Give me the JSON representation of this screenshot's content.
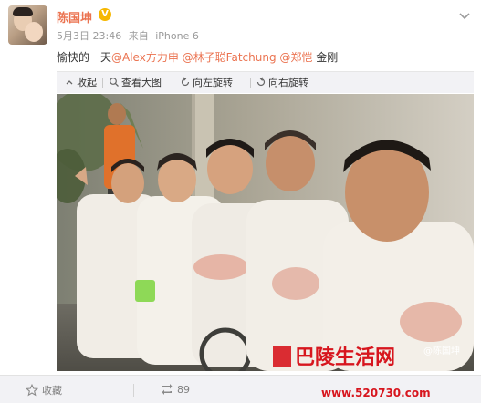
{
  "post": {
    "username": "陈国坤",
    "verified_badge": "V",
    "date": "5月3日 23:46",
    "source_prefix": "来自",
    "source": "iPhone 6",
    "text_prefix": "愉快的一天",
    "mentions": [
      "@Alex方力申",
      "@林子聪Fatchung",
      "@郑恺"
    ],
    "text_suffix": "金刚"
  },
  "toolbar": {
    "collapse_label": "收起",
    "view_large_label": "查看大图",
    "rotate_left_label": "向左旋转",
    "rotate_right_label": "向右旋转"
  },
  "photo": {
    "credit": "@陈国坤",
    "watermark_name": "巴陵生活网",
    "watermark_url": "www.520730.com"
  },
  "footer": {
    "favorite_label": "收藏",
    "repost_count": "89"
  },
  "colors": {
    "accent": "#eb7350",
    "verified": "#f6b700",
    "toolbar_bg": "#f2f2f5",
    "watermark_red": "#d7161e"
  },
  "icons": [
    "chevron-down-icon",
    "collapse-arrow-icon",
    "magnifier-icon",
    "rotate-left-icon",
    "rotate-right-icon",
    "star-icon",
    "repost-icon"
  ]
}
